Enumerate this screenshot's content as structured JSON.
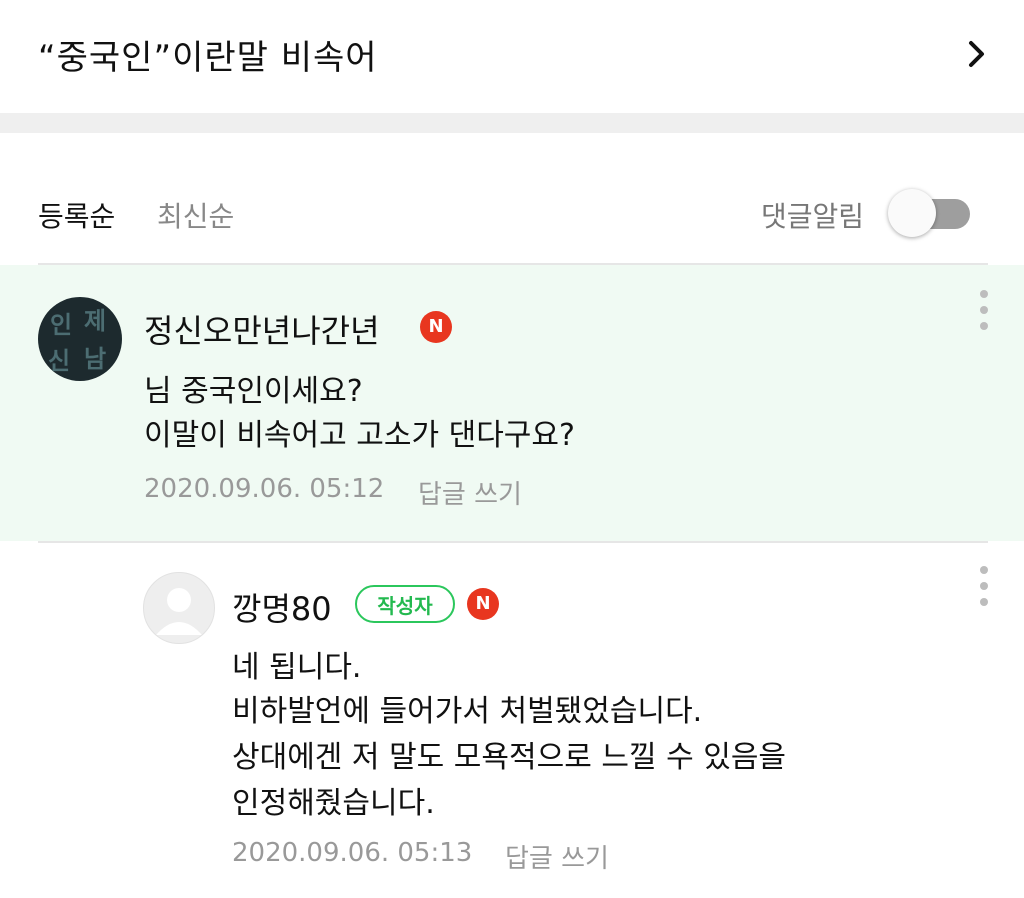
{
  "header": {
    "title": "“중국인”이란말 비속어"
  },
  "sort": {
    "registered": "등록순",
    "latest": "최신순",
    "notify_label": "댓글알림"
  },
  "comments": [
    {
      "nickname": "정신오만년나간년",
      "badge": "N",
      "avatar_text": [
        "인",
        "제",
        "신",
        "남"
      ],
      "lines": [
        "님 중국인이세요?",
        "이말이 비속어고 고소가 댄다구요?"
      ],
      "date": "2020.09.06. 05:12",
      "reply_label": "답글 쓰기"
    },
    {
      "nickname": "깡명80",
      "author_badge": "작성자",
      "badge": "N",
      "lines": [
        "네 됩니다.",
        "비하발언에 들어가서 처벌됐었습니다.",
        "상대에겐 저 말도 모욕적으로 느낄 수 있음을",
        "인정해줬습니다."
      ],
      "date": "2020.09.06. 05:13",
      "reply_label": "답글 쓰기"
    }
  ],
  "colors": {
    "accent_green": "#2bc75c",
    "badge_red": "#e8361f",
    "highlight_bg": "#f0faf3"
  },
  "icons": {
    "chevron": "chevron-right-icon",
    "more": "more-vertical-icon"
  }
}
